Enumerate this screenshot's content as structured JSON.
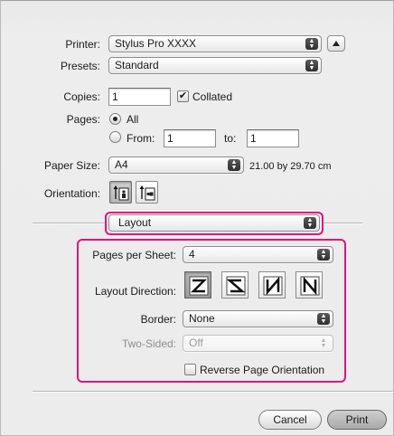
{
  "printer": {
    "label": "Printer:",
    "value": "Stylus Pro XXXX"
  },
  "presets": {
    "label": "Presets:",
    "value": "Standard"
  },
  "copies": {
    "label": "Copies:",
    "value": "1",
    "collated_label": "Collated",
    "collated_checked": true
  },
  "pages": {
    "label": "Pages:",
    "all_label": "All",
    "from_label": "From:",
    "from_value": "1",
    "to_label": "to:",
    "to_value": "1",
    "selected": "All"
  },
  "paper_size": {
    "label": "Paper Size:",
    "value": "A4",
    "dimensions": "21.00 by 29.70 cm"
  },
  "orientation": {
    "label": "Orientation:",
    "options": [
      "portrait",
      "landscape"
    ],
    "selected": "portrait"
  },
  "section": {
    "value": "Layout"
  },
  "layout": {
    "pages_per_sheet": {
      "label": "Pages per Sheet:",
      "value": "4"
    },
    "layout_direction": {
      "label": "Layout Direction:",
      "selected": 0,
      "icons": [
        "z-order-icon",
        "s-order-icon",
        "reverse-n-order-icon",
        "n-order-icon"
      ]
    },
    "border": {
      "label": "Border:",
      "value": "None"
    },
    "two_sided": {
      "label": "Two-Sided:",
      "value": "Off",
      "enabled": false
    },
    "reverse": {
      "label": "Reverse Page Orientation",
      "checked": false
    }
  },
  "buttons": {
    "cancel": "Cancel",
    "print": "Print"
  },
  "colors": {
    "highlight": "#e2127f"
  }
}
